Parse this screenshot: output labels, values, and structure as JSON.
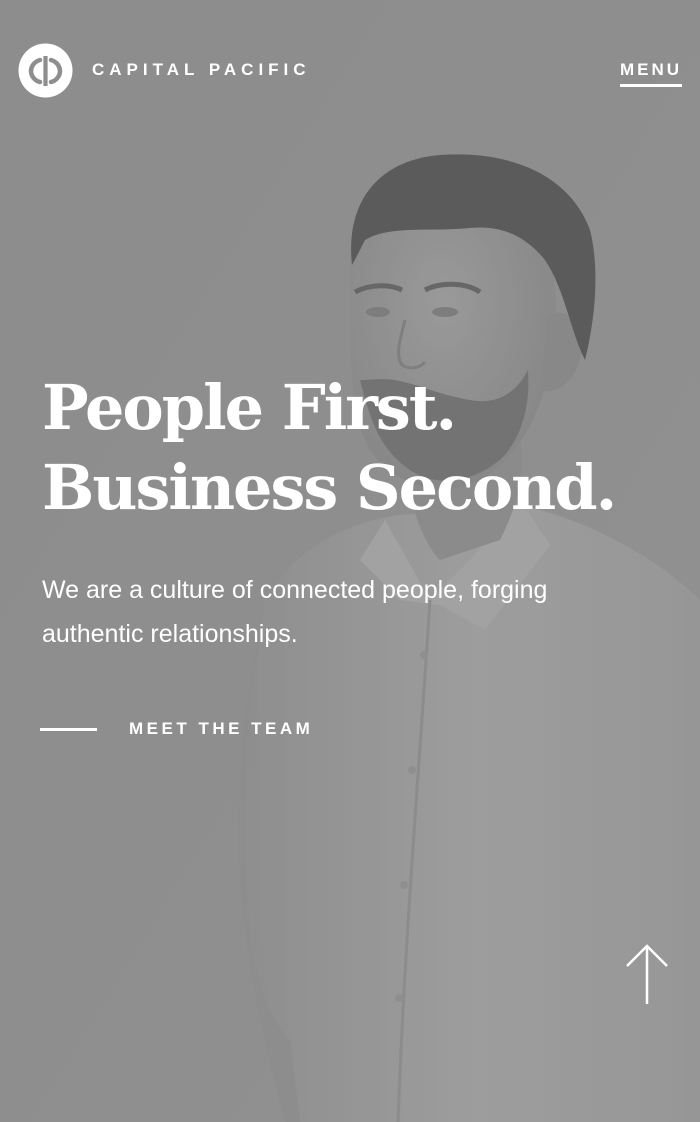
{
  "header": {
    "brand_name": "CAPITAL PACIFIC",
    "logo_icon": "cp-monogram-logo",
    "menu_label": "MENU"
  },
  "hero": {
    "headline_line1": "People First.",
    "headline_line2": "Business Second.",
    "tagline": "We are a culture of connected people, forging authentic relationships.",
    "cta_label": "MEET THE TEAM",
    "scroll_icon": "arrow-up-icon"
  },
  "colors": {
    "background": "#8e8e8e",
    "text": "#ffffff"
  }
}
